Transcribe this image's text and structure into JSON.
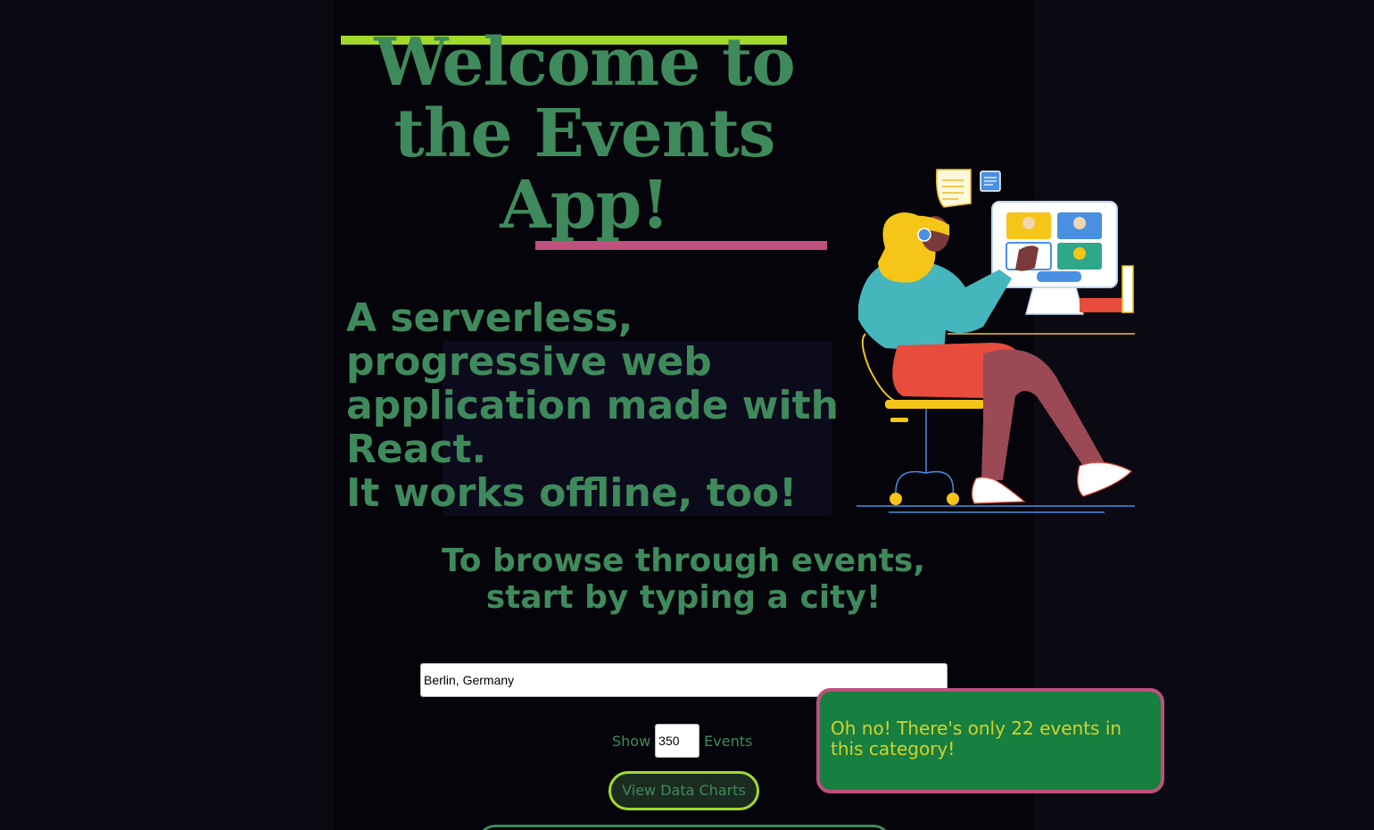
{
  "header": {
    "title_lines": [
      "Welcome to",
      "the Events",
      "App!"
    ]
  },
  "tagline": {
    "lines": [
      "A serverless,",
      "progressive web",
      "application made with",
      "React.",
      "It works offline, too!"
    ]
  },
  "search": {
    "prompt": "To browse through events, start by typing a city!",
    "city_value": "Berlin, Germany"
  },
  "number_of_events": {
    "label_before": "Show",
    "value": "350",
    "label_after": "Events"
  },
  "charts_button": {
    "label": "View Data Charts"
  },
  "alert": {
    "message": "Oh no! There's only 22 events in this category!"
  },
  "colors": {
    "page_background": "#0b0a13",
    "column_background": "#04040a",
    "text_green": "#3f8a5c",
    "accent_lime": "#a2d92a",
    "accent_pink": "#c0507d",
    "alert_background": "#177f3f",
    "alert_text": "#d4d22d"
  },
  "icons": {
    "illustration": "woman-video-call-illustration"
  }
}
